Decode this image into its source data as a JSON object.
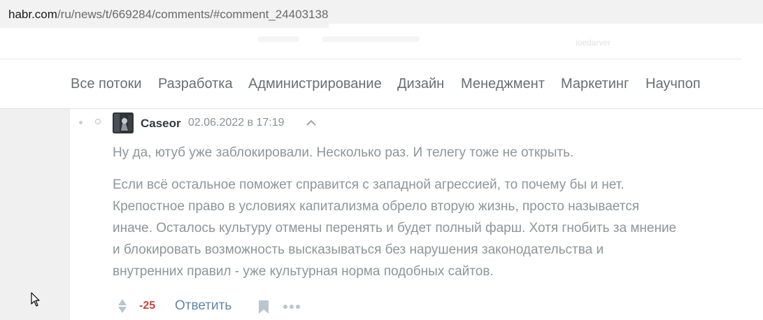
{
  "browser": {
    "url_host": "habr.com",
    "url_path": "/ru/news/t/669284/comments/#comment_24403138"
  },
  "header_ghost_text": "ioedarver",
  "nav": {
    "items": [
      "Все потоки",
      "Разработка",
      "Администрирование",
      "Дизайн",
      "Менеджмент",
      "Маркетинг",
      "Научпоп"
    ]
  },
  "comment": {
    "author": "Caseor",
    "date": "02.06.2022 в 17:19",
    "paragraph1": "Ну да, ютуб уже заблокировали. Несколько раз. И телегу тоже не открыть.",
    "paragraph2_lines": [
      "Если всё остальное поможет справится с западной агрессией, то почему бы и нет.",
      "Крепостное право в условиях капитализма обрело вторую жизнь, просто называется",
      "иначе. Осталось культуру отмены перенять и будет полный фарш. Хотя гнобить за мнение",
      "и блокировать возможность высказываться без нарушения законодательства и",
      "внутренних правил - уже культурная норма подобных сайтов."
    ],
    "score": "-25",
    "reply_label": "Ответить"
  },
  "icons": {
    "avatar": "avatar-image",
    "parent": "chevron-up-icon",
    "vote": "vote-arrows-icon",
    "bookmark": "bookmark-icon",
    "more": "more-dots-icon",
    "cursor": "mouse-pointer-icon"
  },
  "colors": {
    "link": "#5e89a8",
    "score_negative": "#c8423b",
    "nav_text": "#676f75",
    "comment_text": "#8e9599"
  }
}
